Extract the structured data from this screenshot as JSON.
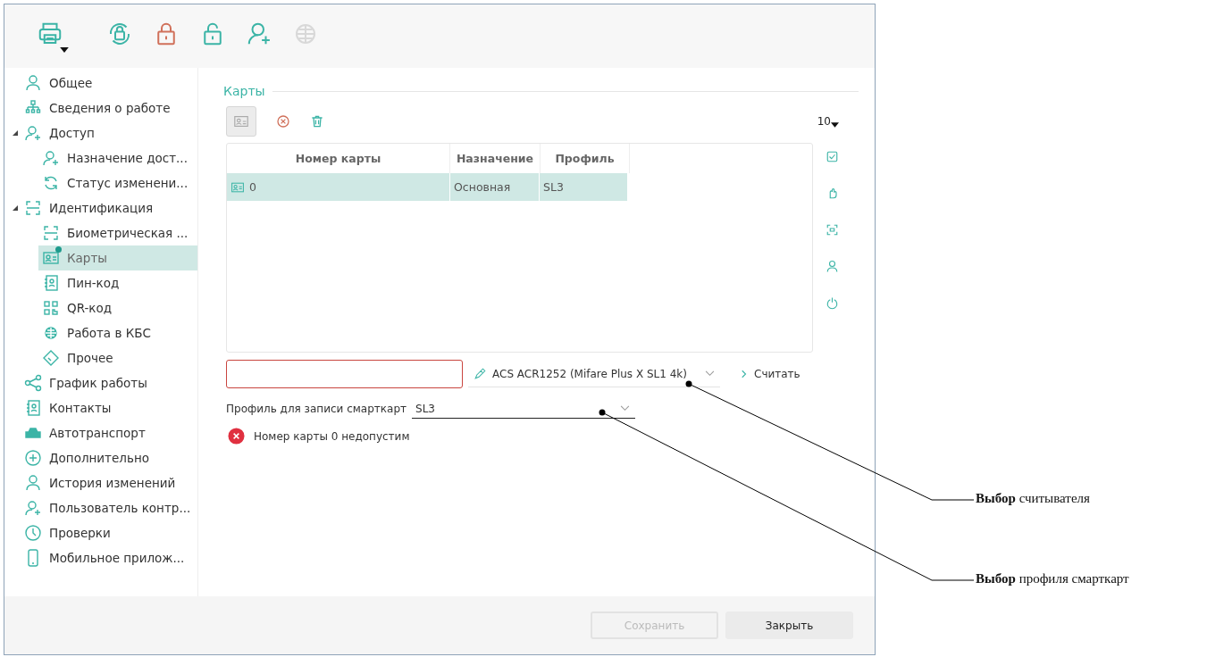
{
  "toolbar": {
    "buttons": [
      {
        "disabled": false,
        "menu": true
      },
      {
        "disabled": false,
        "menu": false
      },
      {
        "disabled": false,
        "menu": false
      },
      {
        "disabled": false,
        "menu": false
      },
      {
        "disabled": false,
        "menu": false
      },
      {
        "disabled": true,
        "menu": false
      }
    ]
  },
  "sidebar": {
    "items": [
      {
        "label": "Общее",
        "selected": false
      },
      {
        "label": "Сведения о работе",
        "selected": false
      },
      {
        "label": "Доступ",
        "selected": false,
        "expanded": true,
        "children": [
          {
            "label": "Назначение дост...",
            "selected": false
          },
          {
            "label": "Статус изменени...",
            "selected": false
          }
        ]
      },
      {
        "label": "Идентификация",
        "selected": false,
        "expanded": true,
        "children": [
          {
            "label": "Биометрическая ...",
            "selected": false
          },
          {
            "label": "Карты",
            "selected": true,
            "badge": true
          },
          {
            "label": "Пин-код",
            "selected": false
          },
          {
            "label": "QR-код",
            "selected": false
          },
          {
            "label": "Работа в КБС",
            "selected": false
          },
          {
            "label": "Прочее",
            "selected": false
          }
        ]
      },
      {
        "label": "График работы",
        "selected": false
      },
      {
        "label": "Контакты",
        "selected": false
      },
      {
        "label": "Автотранспорт",
        "selected": false
      },
      {
        "label": "Дополнительно",
        "selected": false
      },
      {
        "label": "История изменений",
        "selected": false
      },
      {
        "label": "Пользователь контр...",
        "selected": false
      },
      {
        "label": "Проверки",
        "selected": false
      },
      {
        "label": "Мобильное прилож...",
        "selected": false
      }
    ]
  },
  "section": {
    "title": "Карты"
  },
  "page_size": "10",
  "table": {
    "columns": [
      "Номер карты",
      "Назначение",
      "Профиль"
    ],
    "rows": [
      {
        "cells": [
          "0",
          "Основная",
          "SL3"
        ],
        "selected": true
      }
    ]
  },
  "card_number_field": {
    "invalid": true
  },
  "reader": {
    "value": "ACS ACR1252 (Mifare Plus X SL1 4k)"
  },
  "read_button": "Считать",
  "profile": {
    "label": "Профиль для записи смарткарт",
    "value": "SL3"
  },
  "error_message": "Номер карты 0 недопустим",
  "footer": {
    "buttons": [
      {
        "label": "Сохранить",
        "disabled": true
      },
      {
        "label": "Закрыть",
        "disabled": false
      }
    ]
  },
  "callouts": [
    {
      "text": "**Выбор** считывателя"
    },
    {
      "text": "**Выбор** профиля смарткарт"
    }
  ]
}
